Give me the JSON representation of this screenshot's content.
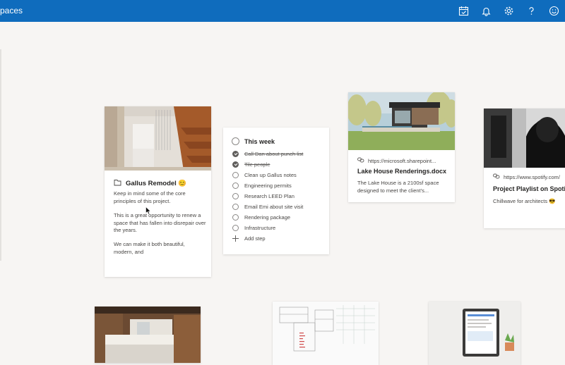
{
  "app": {
    "title": "paces"
  },
  "topbar": {
    "icons": [
      "calendar-check-icon",
      "bell-icon",
      "gear-icon",
      "help-icon",
      "smiley-icon"
    ],
    "color": "#0f6cbd"
  },
  "cards": {
    "gallus": {
      "title": "Gallus Remodel 😊",
      "icon": "notebook-icon",
      "paragraphs": [
        "Keep in mind some of the core principles of this project.",
        "This is a great opportunity to renew a space that has fallen into disrepair over the years.",
        "We can make it both beautiful, modern, and"
      ]
    },
    "todo": {
      "title": "This week",
      "items": [
        {
          "label": "Call Dan about punch list",
          "done": true
        },
        {
          "label": "Tile people",
          "done": true
        },
        {
          "label": "Clean up Gallus notes",
          "done": false
        },
        {
          "label": "Engineering permits",
          "done": false
        },
        {
          "label": "Research LEED Plan",
          "done": false
        },
        {
          "label": "Email Emi about site visit",
          "done": false
        },
        {
          "label": "Rendering package",
          "done": false
        },
        {
          "label": "Infrastructure",
          "done": false
        }
      ],
      "add_step": "Add step"
    },
    "lake": {
      "url": "https://microsoft.sharepoint...",
      "title": "Lake House Renderings.docx",
      "description": "The Lake House is a 2100sf space designed to meet the client's..."
    },
    "spotify": {
      "url": "https://www.spotify.com/",
      "title": "Project Playlist on Spotify",
      "description": "Chillwave for architects 😎"
    }
  }
}
